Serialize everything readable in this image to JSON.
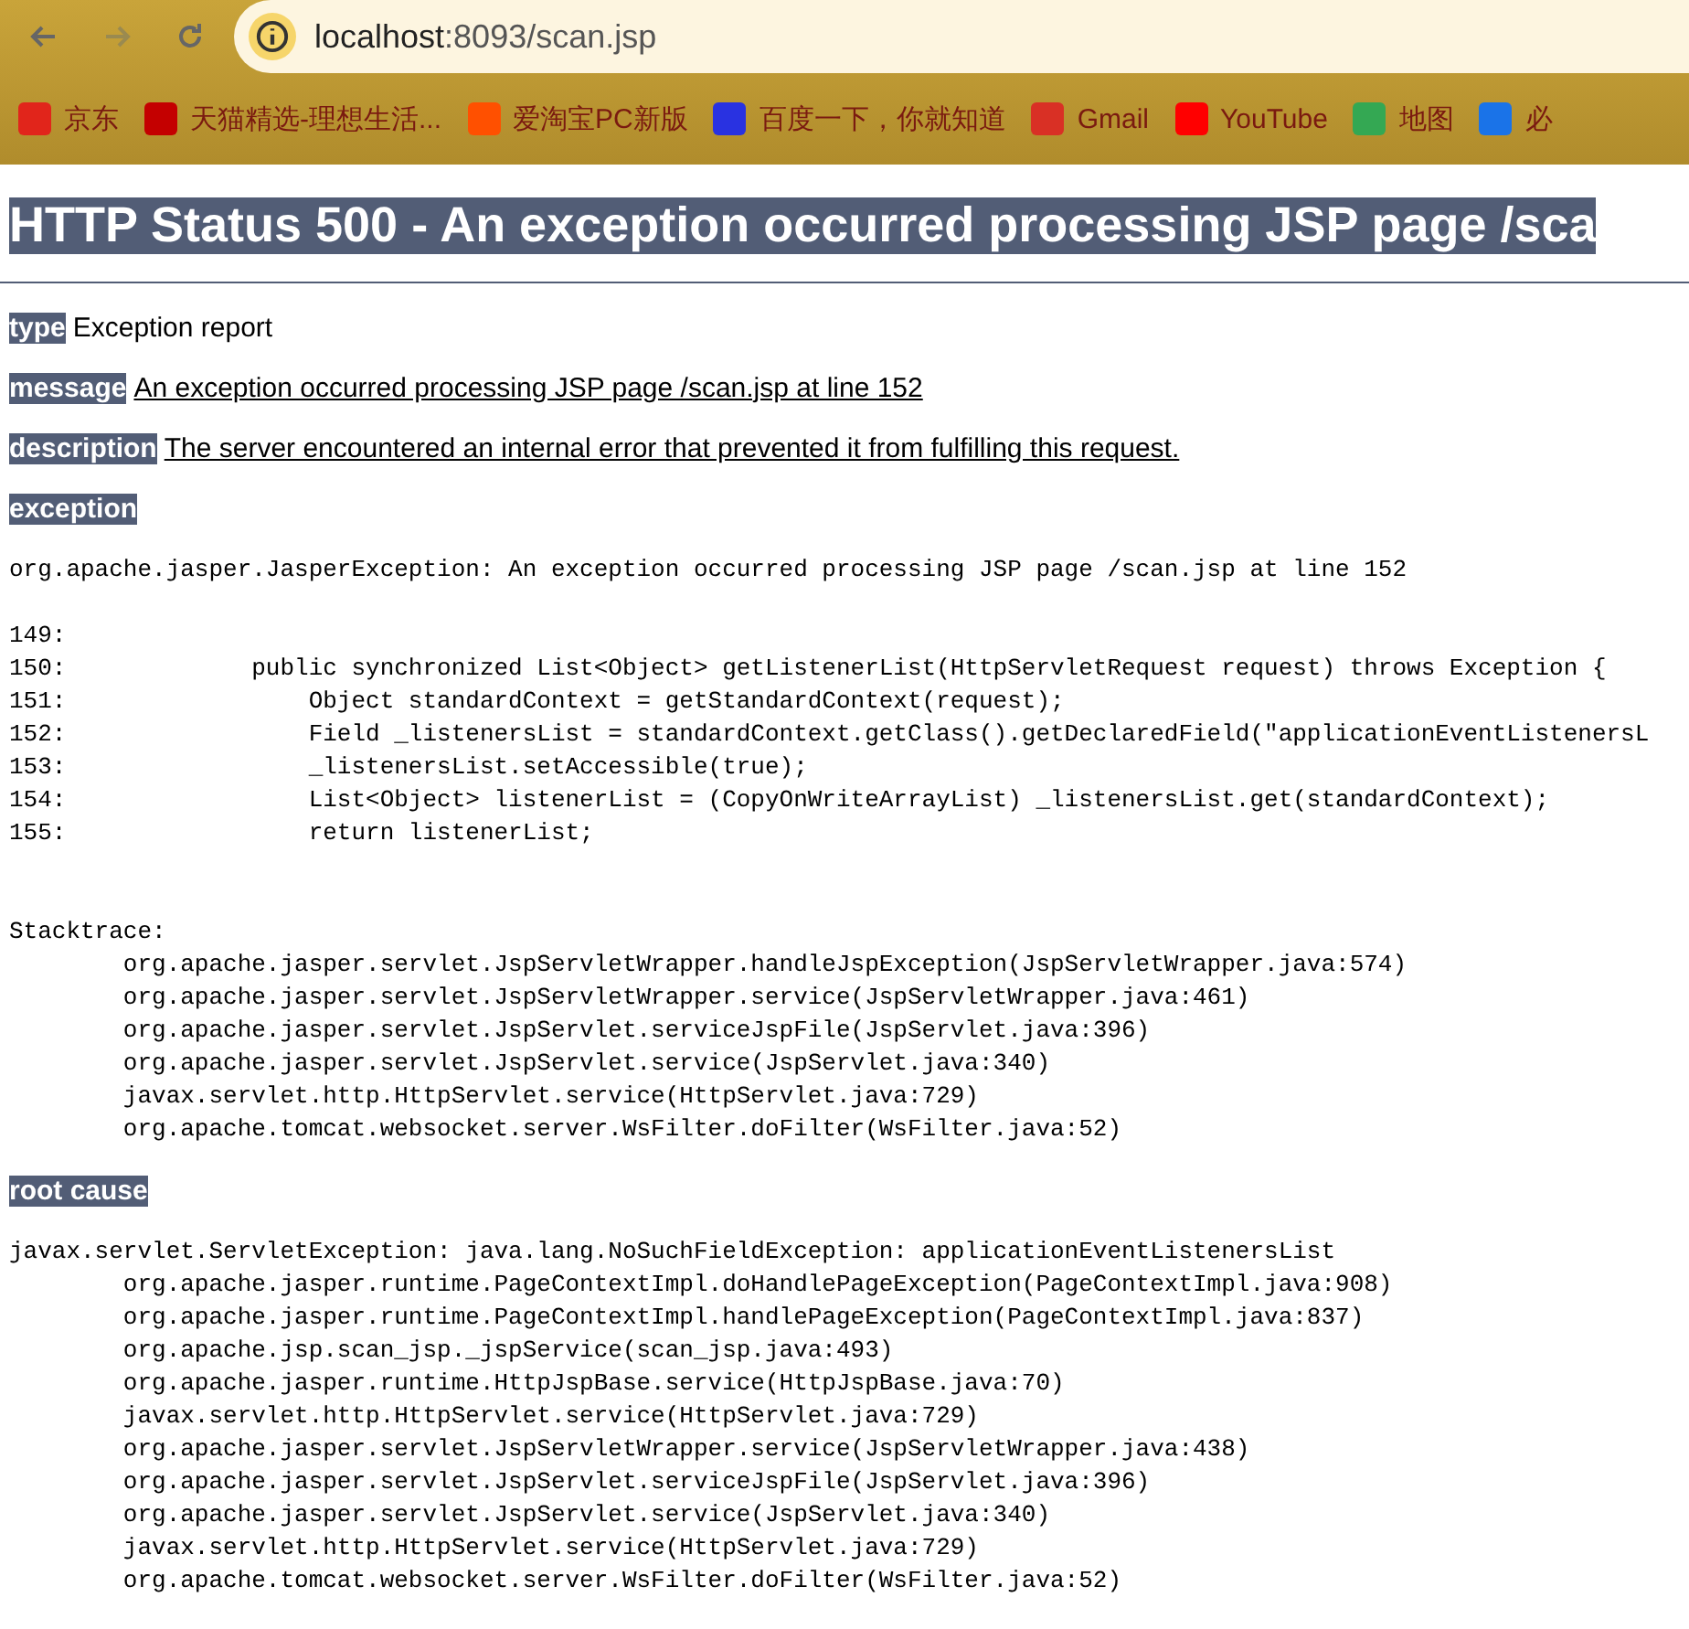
{
  "browser": {
    "url_host": "localhost",
    "url_rest": ":8093/scan.jsp",
    "bookmarks": [
      {
        "label": "京东",
        "color": "#e1251b"
      },
      {
        "label": "天猫精选-理想生活...",
        "color": "#c40000"
      },
      {
        "label": "爱淘宝PC新版",
        "color": "#ff5000"
      },
      {
        "label": "百度一下，你就知道",
        "color": "#2932e1"
      },
      {
        "label": "Gmail",
        "color": "#d93025"
      },
      {
        "label": "YouTube",
        "color": "#ff0000"
      },
      {
        "label": "地图",
        "color": "#34a853"
      },
      {
        "label": "必",
        "color": "#1a73e8"
      }
    ]
  },
  "page": {
    "title": "HTTP Status 500 - An exception occurred processing JSP page /sca",
    "fields": [
      {
        "label": "type",
        "value": "Exception report",
        "link": false
      },
      {
        "label": "message",
        "value": "An exception occurred processing JSP page /scan.jsp at line 152",
        "link": true
      },
      {
        "label": "description",
        "value": "The server encountered an internal error that prevented it from fulfilling this request.",
        "link": true
      }
    ],
    "exception_label": "exception",
    "exception_blocks": [
      [
        "org.apache.jasper.JasperException: An exception occurred processing JSP page /scan.jsp at line 152"
      ],
      [
        "149:",
        "150:             public synchronized List<Object> getListenerList(HttpServletRequest request) throws Exception {",
        "151:                 Object standardContext = getStandardContext(request);",
        "152:                 Field _listenersList = standardContext.getClass().getDeclaredField(\"applicationEventListenersL",
        "153:                 _listenersList.setAccessible(true);",
        "154:                 List<Object> listenerList = (CopyOnWriteArrayList) _listenersList.get(standardContext);",
        "155:                 return listenerList;"
      ],
      [
        "Stacktrace:",
        "        org.apache.jasper.servlet.JspServletWrapper.handleJspException(JspServletWrapper.java:574)",
        "        org.apache.jasper.servlet.JspServletWrapper.service(JspServletWrapper.java:461)",
        "        org.apache.jasper.servlet.JspServlet.serviceJspFile(JspServlet.java:396)",
        "        org.apache.jasper.servlet.JspServlet.service(JspServlet.java:340)",
        "        javax.servlet.http.HttpServlet.service(HttpServlet.java:729)",
        "        org.apache.tomcat.websocket.server.WsFilter.doFilter(WsFilter.java:52)"
      ]
    ],
    "root_cause_label": "root cause",
    "root_cause_lines": [
      "javax.servlet.ServletException: java.lang.NoSuchFieldException: applicationEventListenersList",
      "        org.apache.jasper.runtime.PageContextImpl.doHandlePageException(PageContextImpl.java:908)",
      "        org.apache.jasper.runtime.PageContextImpl.handlePageException(PageContextImpl.java:837)",
      "        org.apache.jsp.scan_jsp._jspService(scan_jsp.java:493)",
      "        org.apache.jasper.runtime.HttpJspBase.service(HttpJspBase.java:70)",
      "        javax.servlet.http.HttpServlet.service(HttpServlet.java:729)",
      "        org.apache.jasper.servlet.JspServletWrapper.service(JspServletWrapper.java:438)",
      "        org.apache.jasper.servlet.JspServlet.serviceJspFile(JspServlet.java:396)",
      "        org.apache.jasper.servlet.JspServlet.service(JspServlet.java:340)",
      "        javax.servlet.http.HttpServlet.service(HttpServlet.java:729)",
      "        org.apache.tomcat.websocket.server.WsFilter.doFilter(WsFilter.java:52)"
    ]
  }
}
